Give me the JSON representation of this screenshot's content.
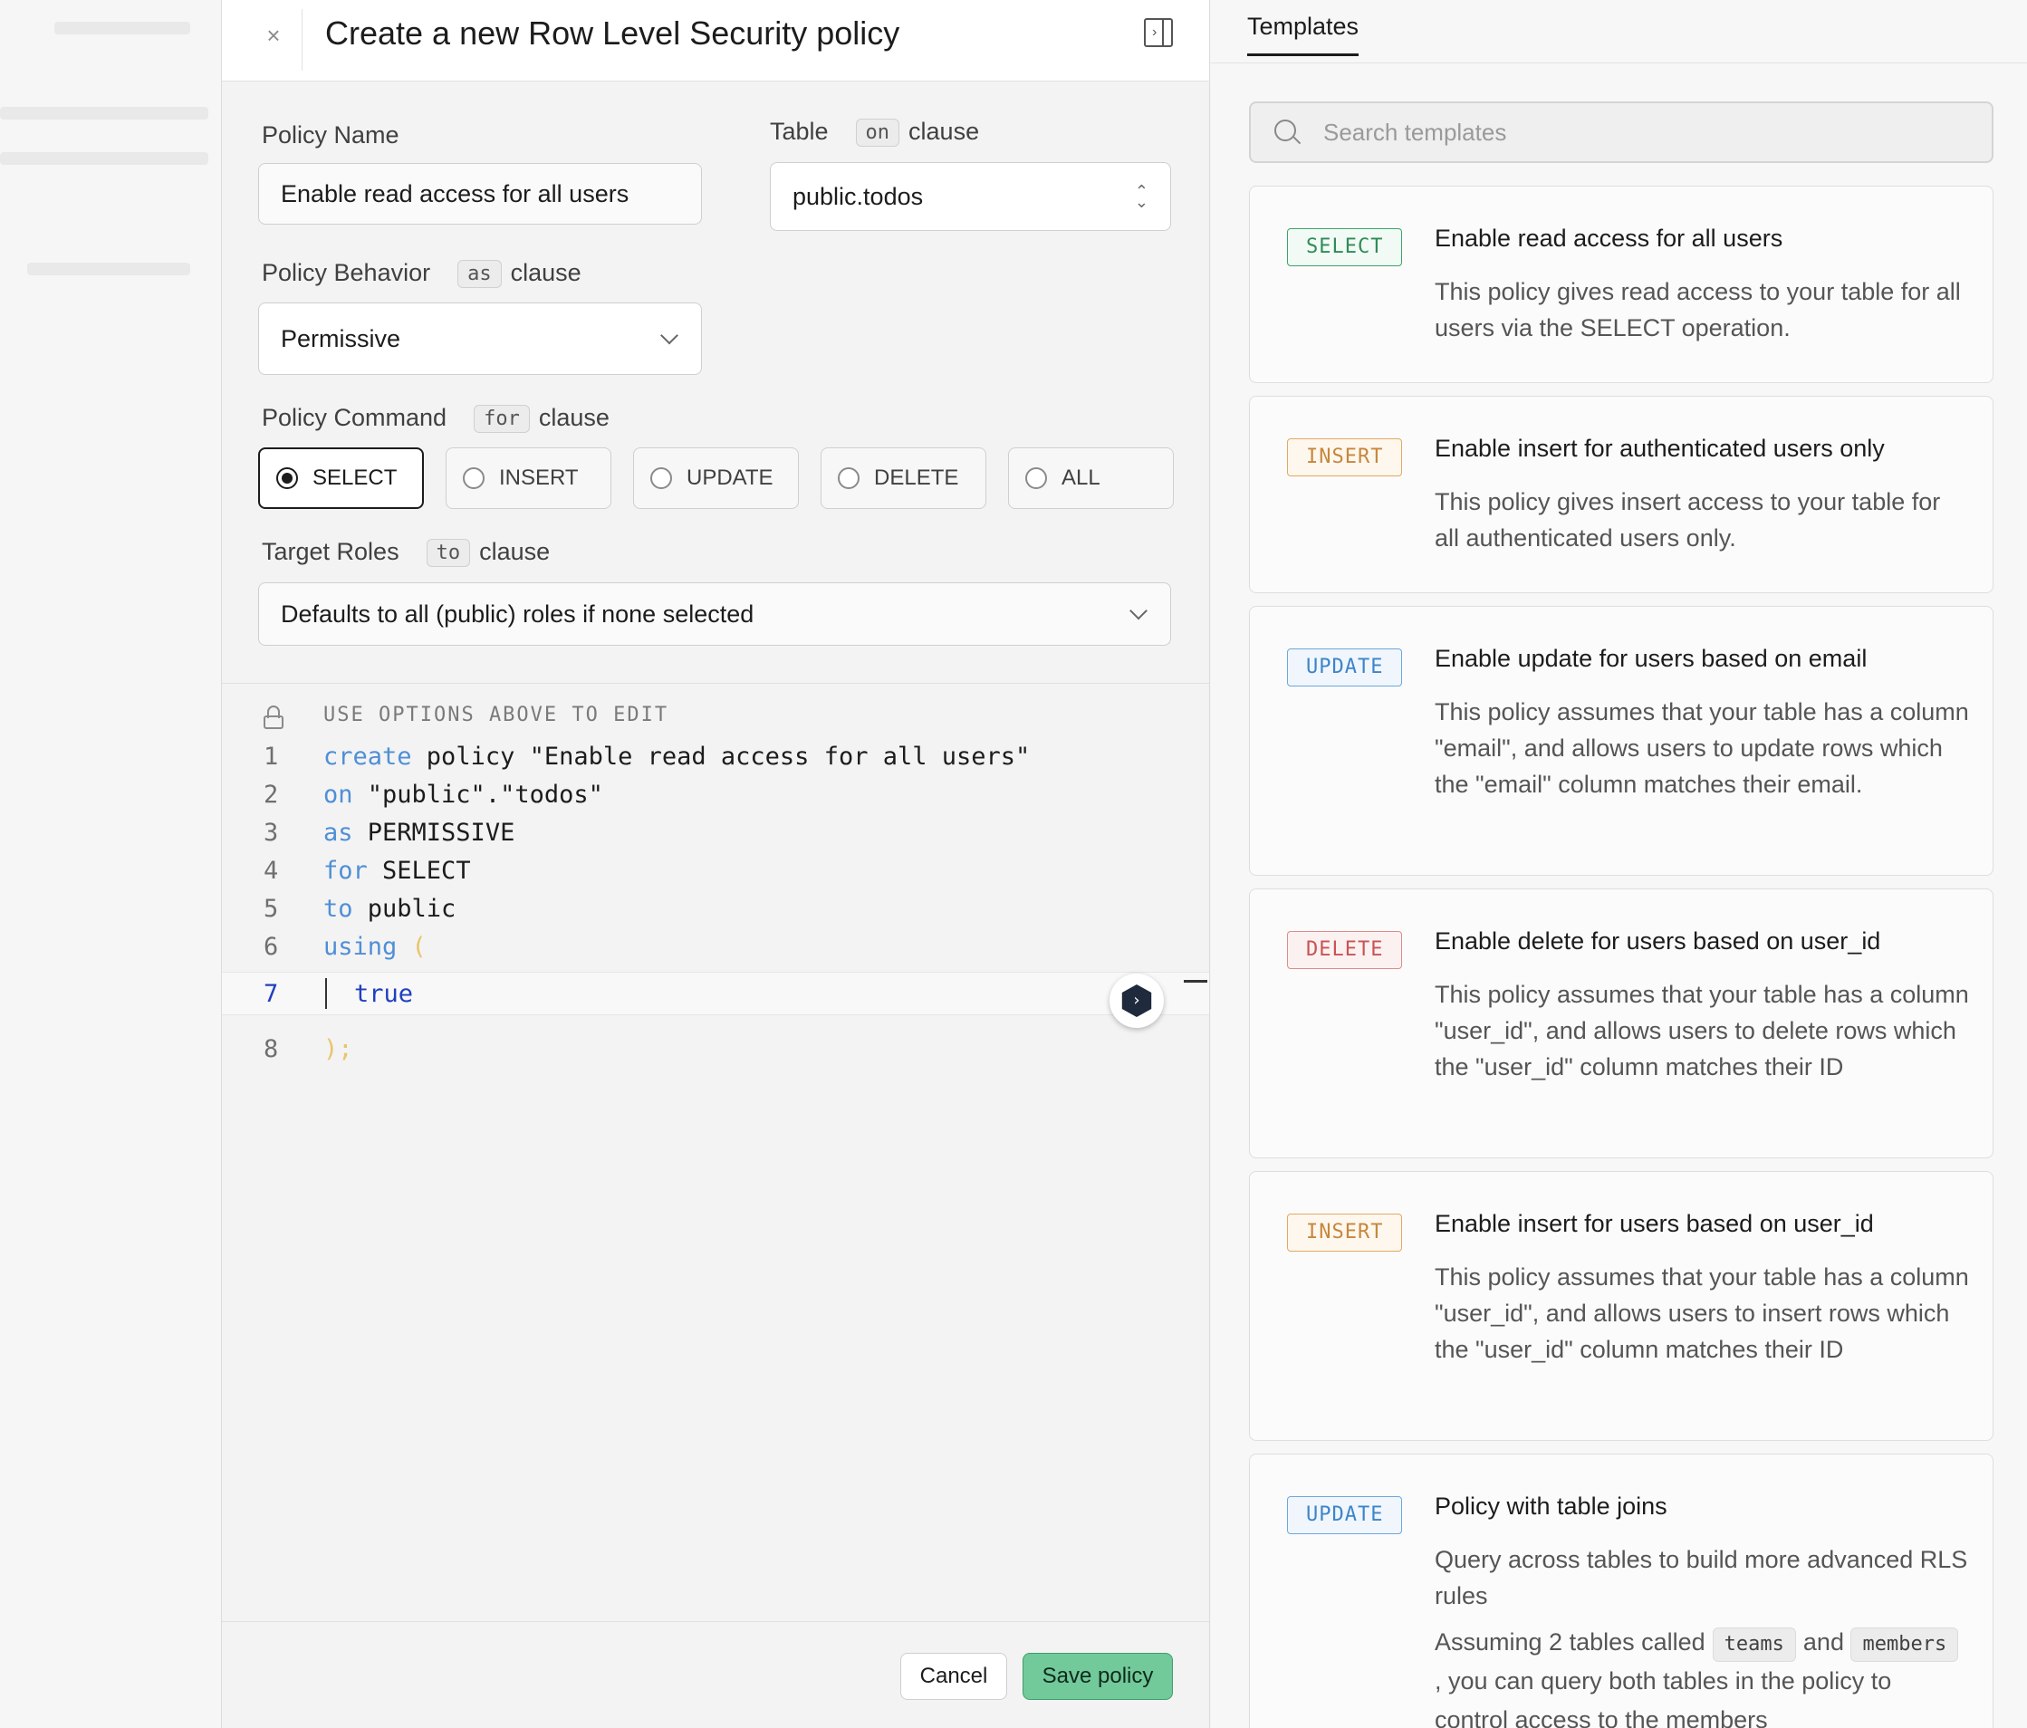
{
  "panel": {
    "close": "×",
    "title": "Create a new Row Level Security policy",
    "toggle": "›"
  },
  "form": {
    "policy_name_label": "Policy Name",
    "policy_name_value": "Enable read access for all users",
    "table_label": "Table",
    "table_chip": "on",
    "table_clause": "clause",
    "table_value": "public.todos",
    "behavior_label": "Policy Behavior",
    "behavior_chip": "as",
    "behavior_clause": "clause",
    "behavior_value": "Permissive",
    "command_label": "Policy Command",
    "command_chip": "for",
    "command_clause": "clause",
    "commands": [
      "SELECT",
      "INSERT",
      "UPDATE",
      "DELETE",
      "ALL"
    ],
    "selected_command": "SELECT",
    "roles_label": "Target Roles",
    "roles_chip": "to",
    "roles_clause": "clause",
    "roles_placeholder": "Defaults to all (public) roles if none selected"
  },
  "editor": {
    "lock_note": "USE OPTIONS ABOVE TO EDIT",
    "lines": [
      {
        "n": "1",
        "kw": "create",
        "rest": " policy \"Enable read access for all users\""
      },
      {
        "n": "2",
        "kw": "on",
        "rest": " \"public\".\"todos\""
      },
      {
        "n": "3",
        "kw": "as",
        "rest": " PERMISSIVE"
      },
      {
        "n": "4",
        "kw": "for",
        "rest": " SELECT"
      },
      {
        "n": "5",
        "kw": "to",
        "rest": " public"
      },
      {
        "n": "6",
        "kw": "using",
        "rest": " ("
      },
      {
        "n": "7",
        "kw": "",
        "rest": "true"
      },
      {
        "n": "8",
        "kw": "",
        "rest": ");"
      }
    ]
  },
  "footer": {
    "cancel": "Cancel",
    "save": "Save policy"
  },
  "templates": {
    "tab": "Templates",
    "search_placeholder": "Search templates",
    "cards": [
      {
        "badge": "SELECT",
        "title": "Enable read access for all users",
        "desc": "This policy gives read access to your table for all users via the SELECT operation."
      },
      {
        "badge": "INSERT",
        "title": "Enable insert for authenticated users only",
        "desc": "This policy gives insert access to your table for all authenticated users only."
      },
      {
        "badge": "UPDATE",
        "title": "Enable update for users based on email",
        "desc": "This policy assumes that your table has a column \"email\", and allows users to update rows which the \"email\" column matches their email."
      },
      {
        "badge": "DELETE",
        "title": "Enable delete for users based on user_id",
        "desc": "This policy assumes that your table has a column \"user_id\", and allows users to delete rows which the \"user_id\" column matches their ID"
      },
      {
        "badge": "INSERT",
        "title": "Enable insert for users based on user_id",
        "desc": "This policy assumes that your table has a column \"user_id\", and allows users to insert rows which the \"user_id\" column matches their ID"
      },
      {
        "badge": "UPDATE",
        "title": "Policy with table joins",
        "desc": "Query across tables to build more advanced RLS rules",
        "desc2_a": "Assuming 2 tables called",
        "chip1": "teams",
        "desc2_b": "and",
        "chip2": "members",
        "desc2_c": ", you can query both tables in the policy to control access to the members"
      }
    ]
  },
  "colors": {
    "save_button": "#72c99a",
    "select_badge": "#2e8b57",
    "insert_badge": "#c7873a",
    "update_badge": "#3c85c9",
    "delete_badge": "#c85454",
    "keyword": "#4f8fd6"
  }
}
